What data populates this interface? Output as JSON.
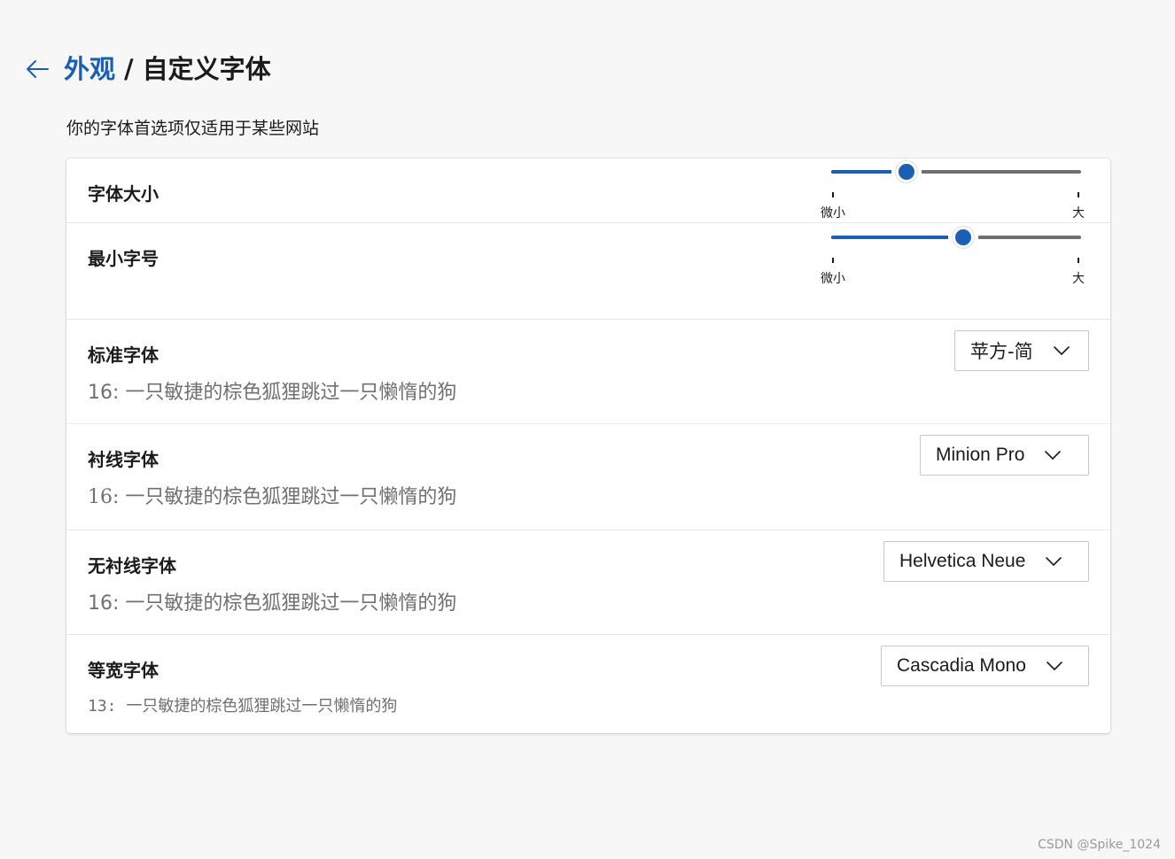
{
  "header": {
    "back_icon": "arrow-left-icon",
    "breadcrumb_parent": "外观",
    "separator": "/",
    "breadcrumb_current": "自定义字体"
  },
  "subtitle": "你的字体首选项仅适用于某些网站",
  "font_size": {
    "label": "字体大小",
    "min_label": "微小",
    "max_label": "大",
    "value_fraction": 0.3
  },
  "min_font_size": {
    "label": "最小字号",
    "min_label": "微小",
    "max_label": "大",
    "value_fraction": 0.53
  },
  "standard_font": {
    "label": "标准字体",
    "sample": "16: 一只敏捷的棕色狐狸跳过一只懒惰的狗",
    "selected": "苹方-简"
  },
  "serif_font": {
    "label": "衬线字体",
    "sample": "16: 一只敏捷的棕色狐狸跳过一只懒惰的狗",
    "selected": "Minion Pro"
  },
  "sans_serif_font": {
    "label": "无衬线字体",
    "sample": "16: 一只敏捷的棕色狐狸跳过一只懒惰的狗",
    "selected": "Helvetica Neue"
  },
  "monospace_font": {
    "label": "等宽字体",
    "sample": "13:  一只敏捷的棕色狐狸跳过一只懒惰的狗",
    "selected": "Cascadia Mono"
  },
  "watermark": "CSDN @Spike_1024",
  "colors": {
    "accent": "#1a5fb4",
    "background": "#f7f7f7",
    "card": "#ffffff",
    "muted_text": "#707070"
  }
}
